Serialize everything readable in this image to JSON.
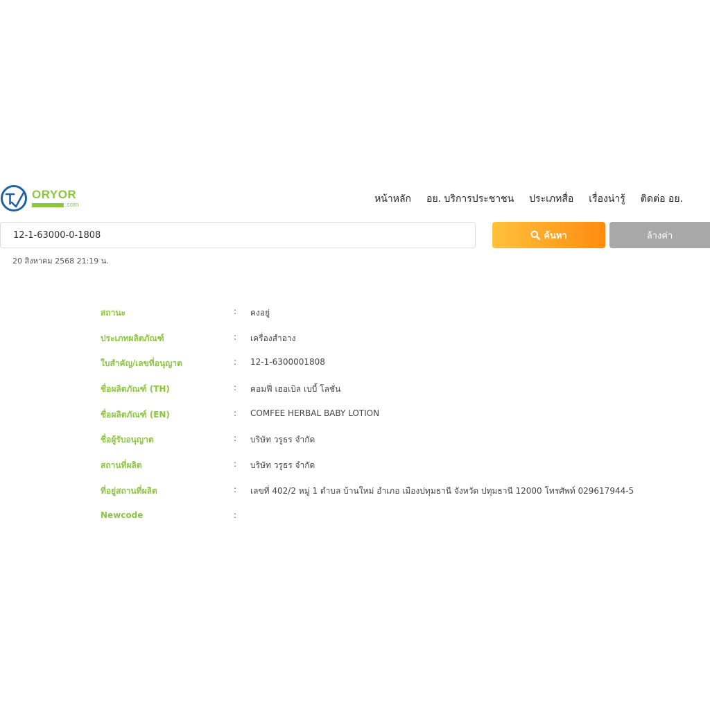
{
  "brand": {
    "name": "ORYOR",
    "suffix": ".com",
    "primary_color": "#8cc63f",
    "mark_color": "#1f5fa8"
  },
  "nav": {
    "items": [
      {
        "label": "หน้าหลัก"
      },
      {
        "label": "อย. บริการประชาชน"
      },
      {
        "label": "ประเภทสื่อ"
      },
      {
        "label": "เรื่องน่ารู้"
      },
      {
        "label": "ติดต่อ อย."
      }
    ]
  },
  "search": {
    "value": "12-1-63000-0-1808",
    "search_label": "ค้นหา",
    "search_icon": "search-icon",
    "clear_label": "ล้างค่า",
    "search_color_start": "#ffc13b",
    "search_color_end": "#ff8c0f",
    "clear_color": "#a8a8a8"
  },
  "timestamp": "20 สิงหาคม 2568 21:19 น.",
  "details": {
    "separator": ":",
    "rows": [
      {
        "label": "สถานะ",
        "value": "คงอยู่"
      },
      {
        "label": "ประเภทผลิตภัณฑ์",
        "value": "เครื่องสำอาง"
      },
      {
        "label": "ใบสำคัญ/เลขที่อนุญาต",
        "value": "12-1-6300001808"
      },
      {
        "label": "ชื่อผลิตภัณฑ์ (TH)",
        "value": "คอมฟี่ เฮอเบิล เบบี้ โลชั่น"
      },
      {
        "label": "ชื่อผลิตภัณฑ์ (EN)",
        "value": "COMFEE HERBAL BABY LOTION"
      },
      {
        "label": "ชื่อผู้รับอนุญาต",
        "value": "บริษัท วรูธร จำกัด"
      },
      {
        "label": "สถานที่ผลิต",
        "value": "บริษัท วรูธร จำกัด"
      },
      {
        "label": "ที่อยู่สถานที่ผลิต",
        "value": "เลขที่ 402/2 หมู่ 1 ตำบล บ้านใหม่ อำเภอ เมืองปทุมธานี จังหวัด ปทุมธานี 12000 โทรศัพท์ 029617944-5"
      },
      {
        "label": "Newcode",
        "value": ""
      }
    ]
  }
}
